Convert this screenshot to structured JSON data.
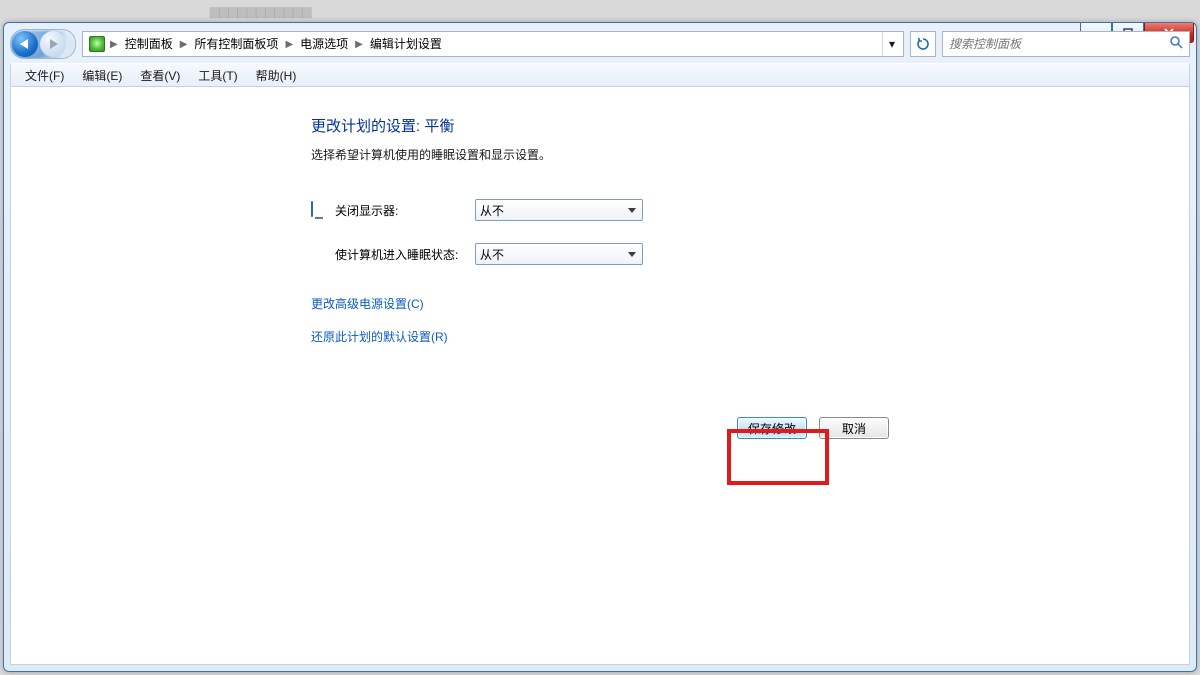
{
  "window_controls": {
    "min": "—",
    "max": "▢",
    "close": "✕"
  },
  "breadcrumb": {
    "items": [
      "控制面板",
      "所有控制面板项",
      "电源选项",
      "编辑计划设置"
    ]
  },
  "refresh_tooltip": "刷新",
  "search": {
    "placeholder": "搜索控制面板"
  },
  "menubar": {
    "items": [
      "文件(F)",
      "编辑(E)",
      "查看(V)",
      "工具(T)",
      "帮助(H)"
    ]
  },
  "page": {
    "title": "更改计划的设置: 平衡",
    "subtitle": "选择希望计算机使用的睡眠设置和显示设置。",
    "rows": [
      {
        "label": "关闭显示器:",
        "value": "从不"
      },
      {
        "label": "使计算机进入睡眠状态:",
        "value": "从不"
      }
    ],
    "links": [
      "更改高级电源设置(C)",
      "还原此计划的默认设置(R)"
    ],
    "save": "保存修改",
    "cancel": "取消"
  }
}
